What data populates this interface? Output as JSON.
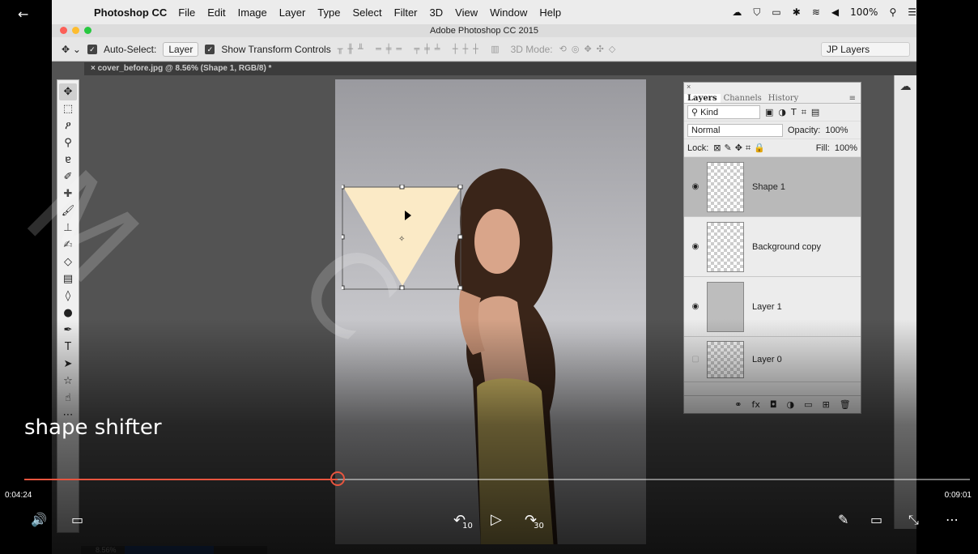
{
  "player": {
    "back_label": "←",
    "title": "shape shifter",
    "time_current": "0:04:24",
    "time_total": "0:09:01",
    "progress": 0.331,
    "accent_color": "#e8553f",
    "controls": {
      "volume": "🔊",
      "captions": "▭",
      "rewind_label": "10",
      "play": "▷",
      "forward_label": "30",
      "edit": "✎",
      "miniplayer": "▭",
      "collapse": "⤡",
      "more": "⋯"
    }
  },
  "menubar": {
    "apple": "",
    "app_name": "Photoshop CC",
    "items": [
      "File",
      "Edit",
      "Image",
      "Layer",
      "Type",
      "Select",
      "Filter",
      "3D",
      "View",
      "Window",
      "Help"
    ],
    "battery": "100%"
  },
  "window": {
    "title": "Adobe Photoshop CC 2015"
  },
  "options": {
    "auto_select_label": "Auto-Select:",
    "auto_select_value": "Layer",
    "show_transform_label": "Show Transform Controls",
    "mode_label": "3D Mode:",
    "workspace": "JP Layers"
  },
  "document": {
    "tab_title": "cover_before.jpg @ 8.56% (Shape 1, RGB/8) *",
    "zoom": "8.56%"
  },
  "tools": [
    "✥",
    "⬚",
    "ዖ",
    "⚲",
    "ɐ",
    "✐",
    "✚",
    "🖌",
    "⊥",
    "✍",
    "◇",
    "▤",
    "◊",
    "●",
    "✒",
    "T",
    "➤",
    "☆",
    "☝",
    "⋯"
  ],
  "layers_panel": {
    "tabs": [
      "Layers",
      "Channels",
      "History"
    ],
    "active_tab": "Layers",
    "kind_label": "Kind",
    "blend_mode": "Normal",
    "opacity_label": "Opacity:",
    "opacity_value": "100%",
    "lock_label": "Lock:",
    "fill_label": "Fill:",
    "fill_value": "100%",
    "layers": [
      {
        "name": "Shape 1",
        "selected": true,
        "visible": true
      },
      {
        "name": "Background copy",
        "selected": false,
        "visible": true
      },
      {
        "name": "Layer 1",
        "selected": false,
        "visible": true
      },
      {
        "name": "Layer 0",
        "selected": false,
        "visible": false
      }
    ]
  },
  "colors": {
    "shape_fill": "#fbeac6",
    "ps_bg": "#535353"
  }
}
